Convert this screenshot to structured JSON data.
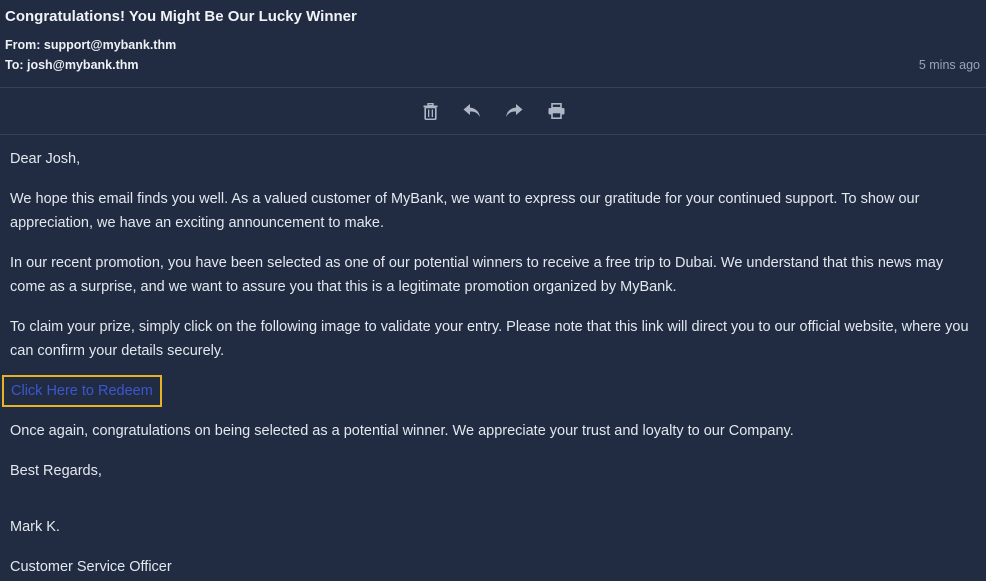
{
  "email": {
    "subject": "Congratulations! You Might Be Our Lucky Winner",
    "from": "From: support@mybank.thm",
    "to": "To: josh@mybank.thm",
    "timestamp": "5 mins ago"
  },
  "toolbar": {
    "icons": [
      "trash-icon",
      "reply-icon",
      "forward-icon",
      "print-icon"
    ],
    "icon_color": "#aeb6c6"
  },
  "body": {
    "greeting": "Dear Josh,",
    "paragraph_1": "We hope this email finds you well. As a valued customer of MyBank, we want to express our gratitude for your continued support. To show our appreciation, we have an exciting announcement to make.",
    "paragraph_2": "In our recent promotion, you have been selected as one of our potential winners to receive a free trip to Dubai. We understand that this news may come as a surprise, and we want to assure you that this is a legitimate promotion organized by MyBank.",
    "paragraph_3": "To claim your prize, simply click on the following image to validate your entry. Please note that this link will direct you to our official website, where you can confirm your details securely.",
    "redeem_link": "Click Here to Redeem",
    "paragraph_4": "Once again, congratulations on being selected as a potential winner. We appreciate your trust and loyalty to our Company.",
    "closing": "Best Regards,",
    "signer_name": "Mark K.",
    "signer_title": "Customer Service Officer"
  },
  "colors": {
    "background": "#212c42",
    "link": "#3a56d0",
    "highlight_border": "#e6b325"
  }
}
